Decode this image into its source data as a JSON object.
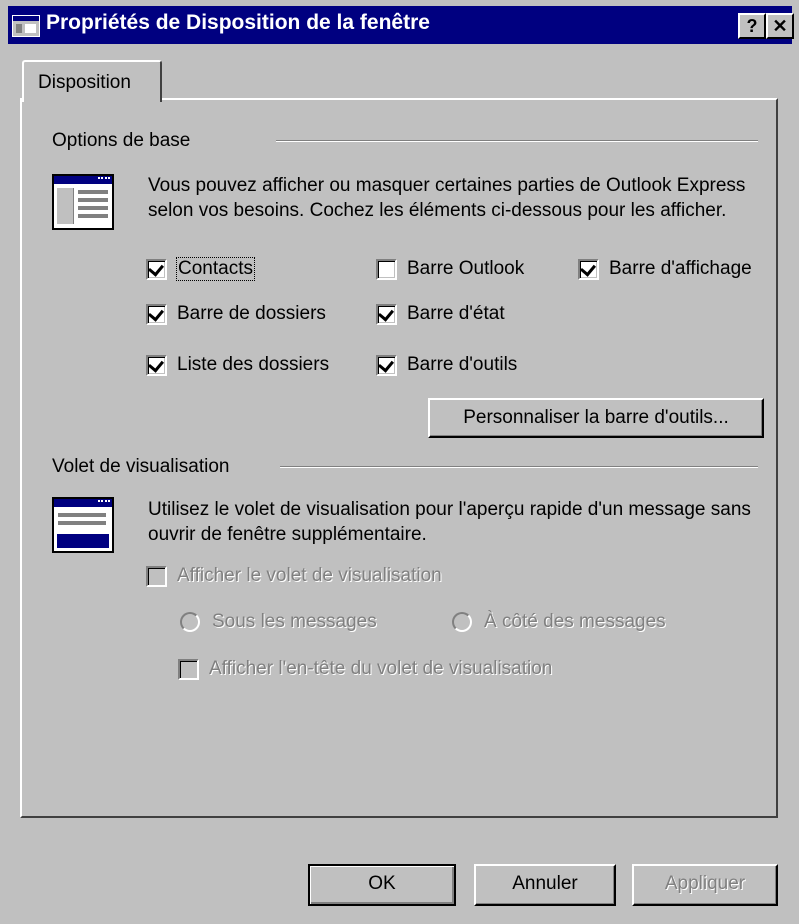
{
  "window": {
    "title": "Propriétés de Disposition de la fenêtre",
    "help_label": "?",
    "close_label": "✕"
  },
  "tabs": [
    {
      "label": "Disposition",
      "selected": true
    }
  ],
  "basic_options": {
    "title": "Options de base",
    "description": "Vous pouvez afficher ou masquer certaines parties de Outlook Express selon vos besoins. Cochez les éléments ci-dessous pour les afficher.",
    "checkboxes": [
      {
        "label": "Contacts",
        "checked": true
      },
      {
        "label": "Barre Outlook",
        "checked": false
      },
      {
        "label": "Barre d'affichage",
        "checked": true
      },
      {
        "label": "Barre de dossiers",
        "checked": true
      },
      {
        "label": "Barre d'état",
        "checked": true
      },
      {
        "label": "Liste des dossiers",
        "checked": true
      },
      {
        "label": "Barre d'outils",
        "checked": true
      }
    ],
    "customize_button": "Personnaliser la barre d'outils..."
  },
  "preview_pane": {
    "title": "Volet de visualisation",
    "description": "Utilisez le volet de visualisation pour l'aperçu rapide d'un message sans ouvrir de fenêtre supplémentaire.",
    "show_preview_label": "Afficher le volet de visualisation",
    "radio_below": "Sous les messages",
    "radio_beside": "À côté des messages",
    "show_header_label": "Afficher l'en-tête du volet de visualisation"
  },
  "footer": {
    "ok_label": "OK",
    "cancel_label": "Annuler",
    "apply_label": "Appliquer"
  },
  "colors": {
    "titlebar": "#000080",
    "face": "#c0c0c0",
    "disabled_text": "#808080"
  }
}
